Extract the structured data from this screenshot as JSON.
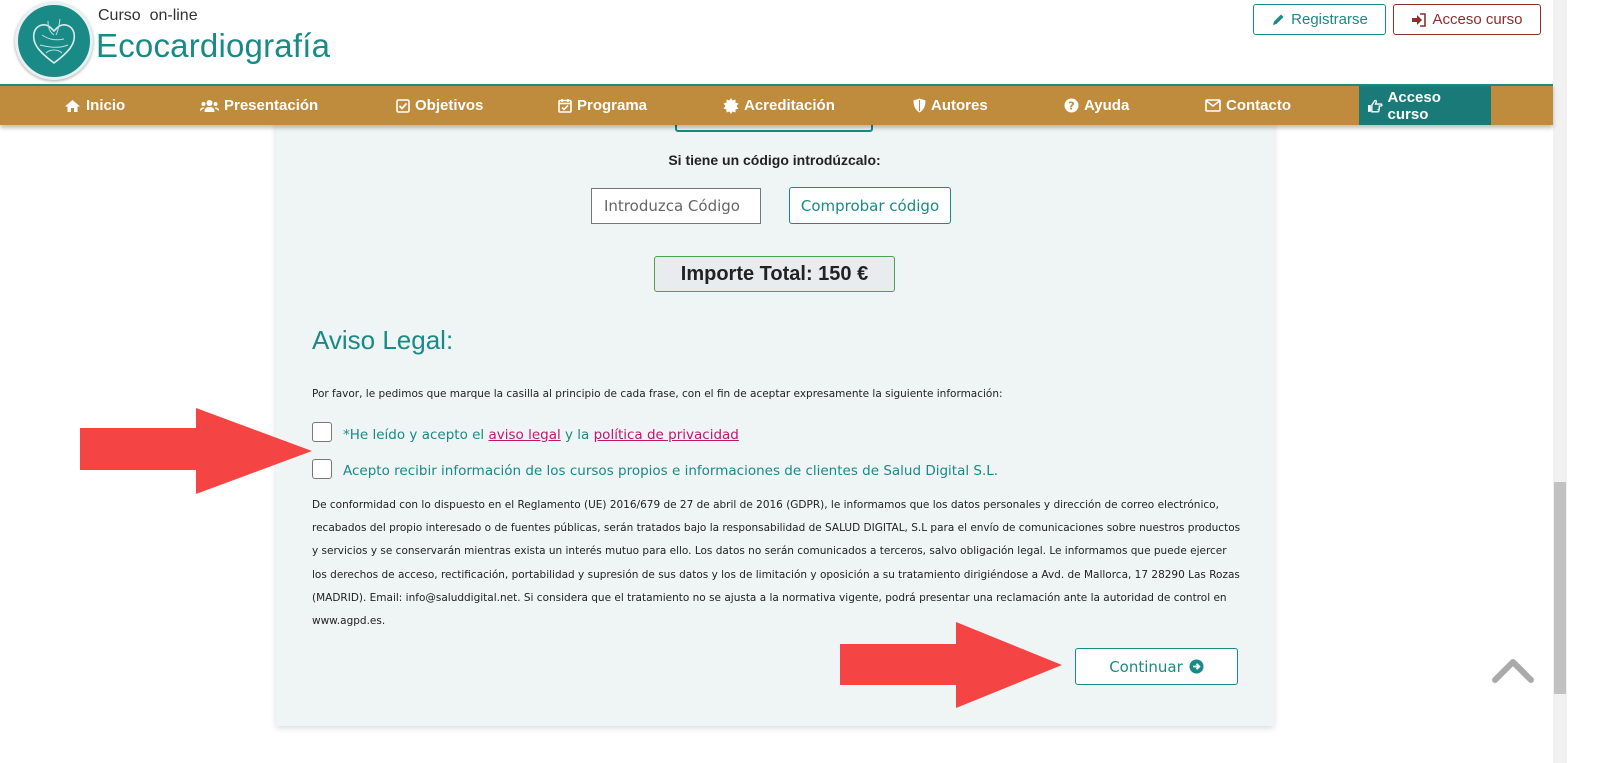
{
  "header": {
    "brand_small": "Curso  on-line",
    "brand_big": "Ecocardiografía",
    "register_label": "Registrarse",
    "access_label": "Acceso curso",
    "logo_icon": "heart-logo-icon"
  },
  "nav": {
    "items": [
      {
        "label": "Inicio",
        "icon": "home-icon"
      },
      {
        "label": "Presentación",
        "icon": "users-icon"
      },
      {
        "label": "Objetivos",
        "icon": "check-square-icon"
      },
      {
        "label": "Programa",
        "icon": "calendar-check-icon"
      },
      {
        "label": "Acreditación",
        "icon": "certificate-icon"
      },
      {
        "label": "Autores",
        "icon": "shield-icon"
      },
      {
        "label": "Ayuda",
        "icon": "question-circle-icon"
      },
      {
        "label": "Contacto",
        "icon": "envelope-icon"
      },
      {
        "label": "Acceso curso",
        "icon": "hand-point-right-icon",
        "active": true
      }
    ]
  },
  "code": {
    "label": "Si tiene un código introdúzcalo:",
    "placeholder": "Introduzca Código",
    "button": "Comprobar código"
  },
  "total": {
    "text": "Importe Total: 150 €"
  },
  "legal": {
    "title": "Aviso Legal:",
    "intro": "Por favor, le pedimos que marque la casilla al principio de cada frase, con el fin de aceptar expresamente la siguiente información:",
    "check1": {
      "prefix": "*He leído y acepto el ",
      "link1": "aviso legal",
      "middle": " y la ",
      "link2": "política de privacidad",
      "checked": false
    },
    "check2": {
      "text": "Acepto recibir información de los cursos propios e informaciones de clientes de Salud Digital S.L.",
      "checked": false
    },
    "gdpr": "De conformidad con lo dispuesto en el Reglamento (UE) 2016/679 de 27 de abril de 2016 (GDPR), le informamos que los datos personales y dirección de correo electrónico, recabados del propio interesado o de fuentes públicas, serán tratados bajo la responsabilidad de SALUD DIGITAL, S.L para el envío de comunicaciones sobre nuestros productos y servicios y se conservarán mientras exista un interés mutuo para ello. Los datos no serán comunicados a terceros, salvo obligación legal. Le informamos que puede ejercer los derechos de acceso, rectificación, portabilidad y supresión de sus datos y los de limitación y oposición a su tratamiento dirigiéndose a Avd. de Mallorca, 17 28290 Las Rozas (MADRID). Email: info@saluddigital.net. Si considera que el tratamiento no se ajusta a la normativa vigente, podrá presentar una reclamación ante la autoridad de control en www.agpd.es.",
    "continue": "Continuar"
  },
  "colors": {
    "teal": "#1a8a86",
    "nav_bg": "#bf8b3d",
    "nav_active": "#1a7a78",
    "access_red": "#8b2f2f",
    "link_pink": "#c0176e",
    "annotation_arrow": "#f44444",
    "panel_bg": "#eef5f4"
  }
}
